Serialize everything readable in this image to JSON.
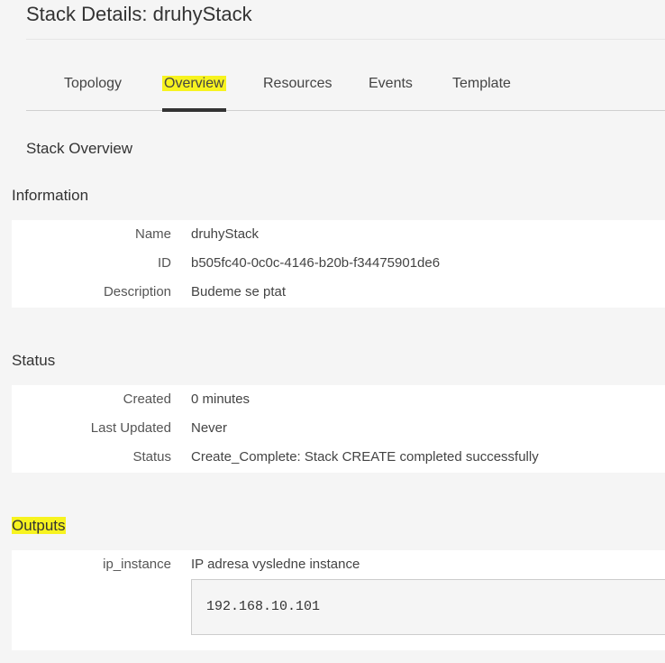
{
  "page": {
    "title": "Stack Details: druhyStack"
  },
  "tabs": [
    {
      "label": "Topology",
      "active": false
    },
    {
      "label": "Overview",
      "active": true
    },
    {
      "label": "Resources",
      "active": false
    },
    {
      "label": "Events",
      "active": false
    },
    {
      "label": "Template",
      "active": false
    }
  ],
  "overview": {
    "heading": "Stack Overview"
  },
  "information": {
    "heading": "Information",
    "rows": [
      {
        "label": "Name",
        "value": "druhyStack"
      },
      {
        "label": "ID",
        "value": "b505fc40-0c0c-4146-b20b-f34475901de6"
      },
      {
        "label": "Description",
        "value": "Budeme se ptat"
      }
    ]
  },
  "status": {
    "heading": "Status",
    "rows": [
      {
        "label": "Created",
        "value": "0 minutes"
      },
      {
        "label": "Last Updated",
        "value": "Never"
      },
      {
        "label": "Status",
        "value": "Create_Complete: Stack CREATE completed successfully"
      }
    ]
  },
  "outputs": {
    "heading": "Outputs",
    "items": [
      {
        "key": "ip_instance",
        "description": "IP adresa vysledne instance",
        "value": "192.168.10.101"
      }
    ]
  },
  "colors": {
    "highlight": "#f7f31f",
    "background": "#f5f5f5",
    "panel": "#ffffff",
    "active_tab_indicator": "#333333"
  }
}
